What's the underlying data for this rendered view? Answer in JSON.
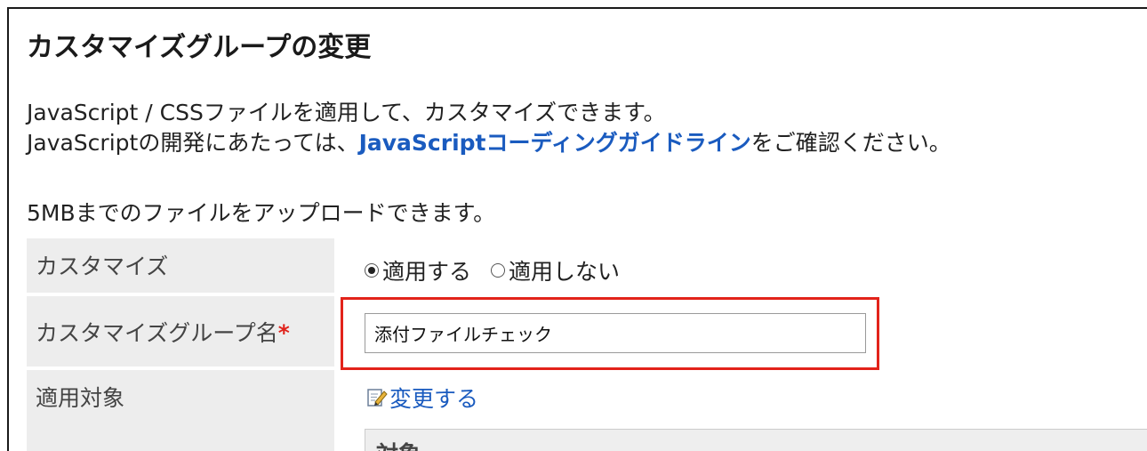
{
  "page": {
    "title": "カスタマイズグループの変更"
  },
  "description": {
    "line1": "JavaScript / CSSファイルを適用して、カスタマイズできます。",
    "line2_prefix": "JavaScriptの開発にあたっては、",
    "line2_link": "JavaScriptコーディングガイドライン",
    "line2_suffix": "をご確認ください。",
    "line3": "5MBまでのファイルをアップロードできます。"
  },
  "form": {
    "customize": {
      "label": "カスタマイズ",
      "options": [
        "適用する",
        "適用しない"
      ],
      "selected": "適用する"
    },
    "group_name": {
      "label": "カスタマイズグループ名",
      "required_mark": "*",
      "value": "添付ファイルチェック"
    },
    "target": {
      "label": "適用対象",
      "change_link": "変更する",
      "table_header": "対象"
    }
  },
  "colors": {
    "link": "#1a5bbf",
    "required": "#e0221b",
    "highlight_border": "#e2231a",
    "label_bg": "#ededed"
  },
  "icons": {
    "change_link_icon": "edit-icon"
  }
}
